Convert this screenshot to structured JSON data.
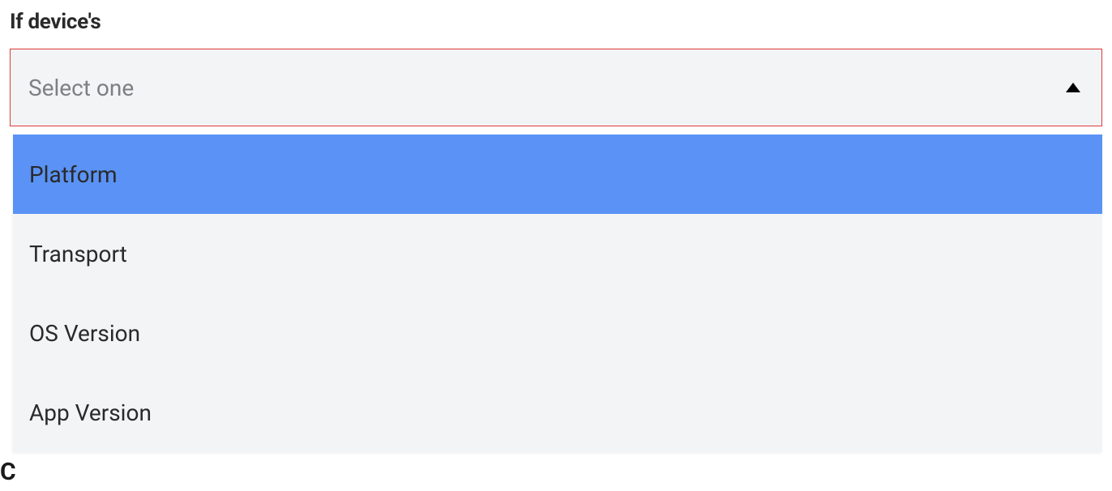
{
  "label": "If device's",
  "select": {
    "placeholder": "Select one",
    "options": [
      "Platform",
      "Transport",
      "OS Version",
      "App Version"
    ],
    "highlighted_index": 0
  },
  "cut_text": "C"
}
